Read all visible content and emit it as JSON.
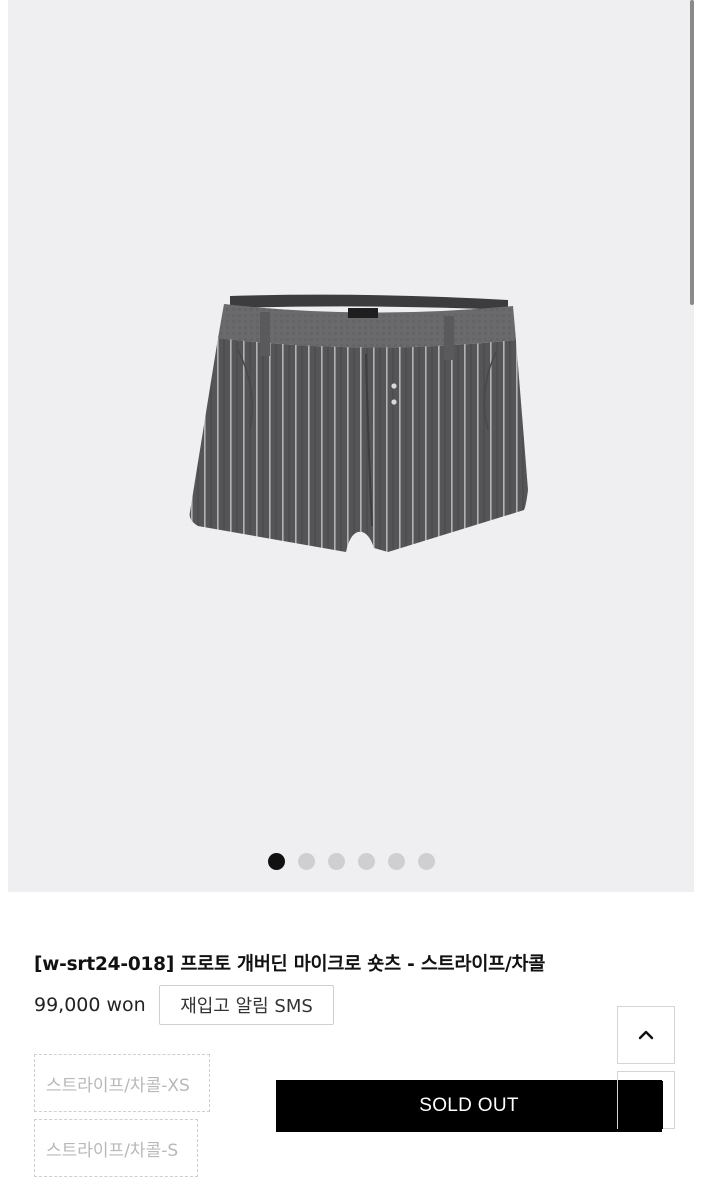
{
  "gallery": {
    "image_alt": "grey pinstripe micro shorts",
    "slide_count": 6,
    "active_index": 0
  },
  "product": {
    "title": "[w-srt24-018] 프로토 개버딘 마이크로 숏츠 - 스트라이프/차콜",
    "price": "99,000 won",
    "restock_label": "재입고 알림 SMS",
    "options": [
      "스트라이프/차콜-XS",
      "스트라이프/차콜-S"
    ],
    "soldout_label": "SOLD OUT"
  },
  "colors": {
    "gallery_bg": "#efeff1",
    "soldout_bg": "#000000",
    "dot_active": "#111111",
    "dot_inactive": "#cfcfd2"
  },
  "icons": {
    "scroll_top": "chevron-up-icon"
  }
}
